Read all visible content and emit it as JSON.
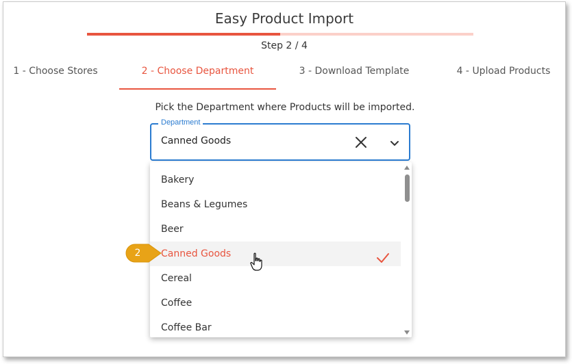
{
  "app": {
    "title": "Easy Product Import",
    "step_indicator": "Step 2 / 4",
    "progress_fraction": 0.5
  },
  "tabs": [
    {
      "label": "1 - Choose Stores",
      "active": false
    },
    {
      "label": "2 - Choose Department",
      "active": true
    },
    {
      "label": "3 - Download Template",
      "active": false
    },
    {
      "label": "4 - Upload Products",
      "active": false
    }
  ],
  "instruction": "Pick the Department where Products will be imported.",
  "department_select": {
    "label": "Department",
    "value": "Canned Goods",
    "clear_icon": "close-icon",
    "expand_icon": "chevron-down-icon"
  },
  "dropdown": {
    "options": [
      {
        "label": "Bakery",
        "selected": false
      },
      {
        "label": "Beans & Legumes",
        "selected": false
      },
      {
        "label": "Beer",
        "selected": false
      },
      {
        "label": "Canned Goods",
        "selected": true
      },
      {
        "label": "Cereal",
        "selected": false
      },
      {
        "label": "Coffee",
        "selected": false
      },
      {
        "label": "Coffee Bar",
        "selected": false
      }
    ]
  },
  "callout": {
    "number": "2"
  },
  "colors": {
    "accent": "#e8553f",
    "accent_light": "#fbd0c9",
    "focus_blue": "#2a7bd0",
    "callout_gold": "#e8a317"
  }
}
